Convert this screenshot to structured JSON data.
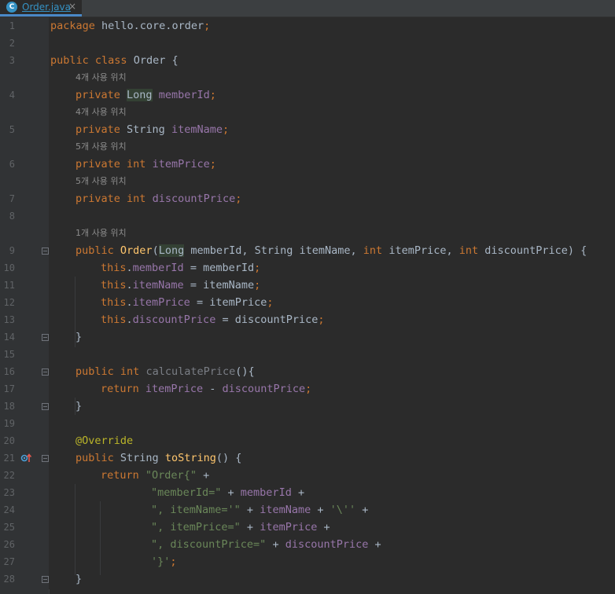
{
  "tab": {
    "icon_letter": "C",
    "title": "Order.java",
    "close": "×"
  },
  "hints": {
    "h4a": "4개 사용 위치",
    "h4b": "4개 사용 위치",
    "h5a": "5개 사용 위치",
    "h5b": "5개 사용 위치",
    "h1": "1개 사용 위치"
  },
  "line_numbers": [
    "1",
    "2",
    "3",
    "4",
    "5",
    "6",
    "7",
    "8",
    "9",
    "10",
    "11",
    "12",
    "13",
    "14",
    "15",
    "16",
    "17",
    "18",
    "19",
    "20",
    "21",
    "22",
    "23",
    "24",
    "25",
    "26",
    "27",
    "28"
  ],
  "tokens": {
    "package": "package",
    "pkg_name": " hello.core.order",
    "semi": ";",
    "public": "public",
    "class": "class",
    "class_name": " Order {",
    "private": "private",
    "long": "Long",
    "string": " String ",
    "int": "int",
    "f_memberId": "memberId",
    "f_itemName": "itemName",
    "f_itemPrice": "itemPrice",
    "f_discountPrice": "discountPrice",
    "ctor_name": "Order",
    "ctor_params_a": " memberId, String itemName, ",
    "ctor_params_b": " itemPrice, ",
    "ctor_params_c": " discountPrice) {",
    "this": "this",
    "assign_memberId": " = memberId",
    "assign_itemName": " = itemName",
    "assign_itemPrice": " = itemPrice",
    "assign_discountPrice": " = discountPrice",
    "close_brace": "}",
    "calc_name": "calculatePrice",
    "calc_paren": "(){",
    "return": "return",
    "minus": " - ",
    "override": "@Override",
    "tostring_name": "toString",
    "tostring_paren": "() {",
    "s_order": "\"Order{\"",
    "plus": " +",
    "s_memberId": "\"memberId=\"",
    "s_itemName": "\", itemName='\"",
    "s_quote": "'\\''",
    "s_itemPrice": "\", itemPrice=\"",
    "s_discountPrice": "\", discountPrice=\"",
    "s_close": "'}'",
    "plus_mid": " + ",
    "dot": ".",
    "lparen": "("
  }
}
